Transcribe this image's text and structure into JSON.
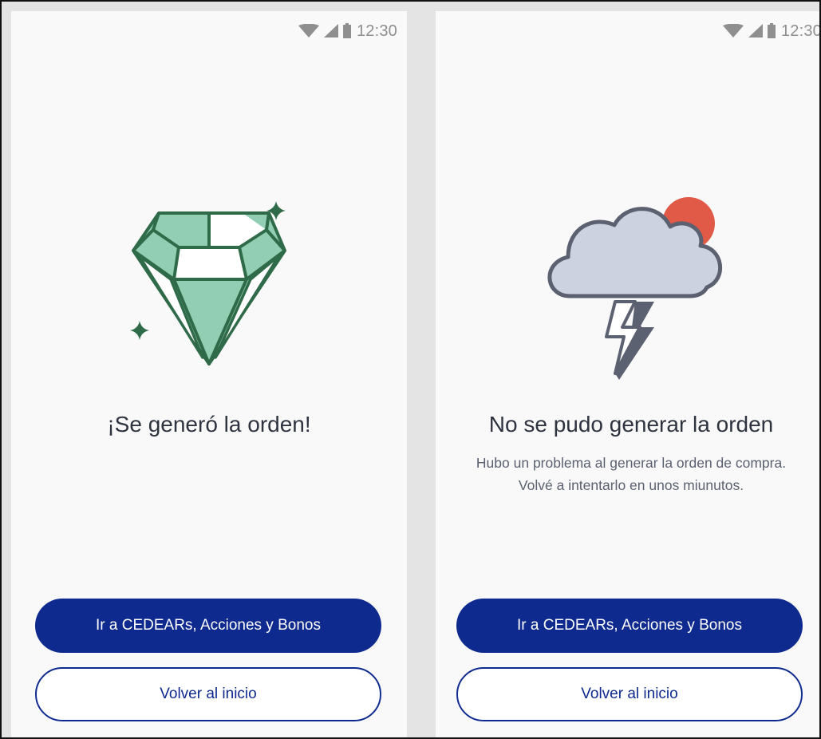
{
  "status_bar": {
    "time": "12:30"
  },
  "screens": [
    {
      "title": "¡Se generó la orden!",
      "illustration": "diamond-icon",
      "primary_button": "Ir a CEDEARs, Acciones y Bonos",
      "secondary_button": "Volver al inicio"
    },
    {
      "title": "No se pudo generar la orden",
      "message_line1": "Hubo un problema al generar la orden de compra.",
      "message_line2": "Volvé a intentarlo en unos miunutos.",
      "illustration": "storm-cloud-icon",
      "primary_button": "Ir a CEDEARs, Acciones y Bonos",
      "secondary_button": "Volver al inicio"
    }
  ],
  "colors": {
    "primary": "#0e2a8f",
    "success_green": "#2f6a49",
    "success_fill": "#92ceb4",
    "cloud_fill": "#cdd2e0",
    "cloud_stroke": "#5b6170",
    "sun": "#e05a47"
  }
}
